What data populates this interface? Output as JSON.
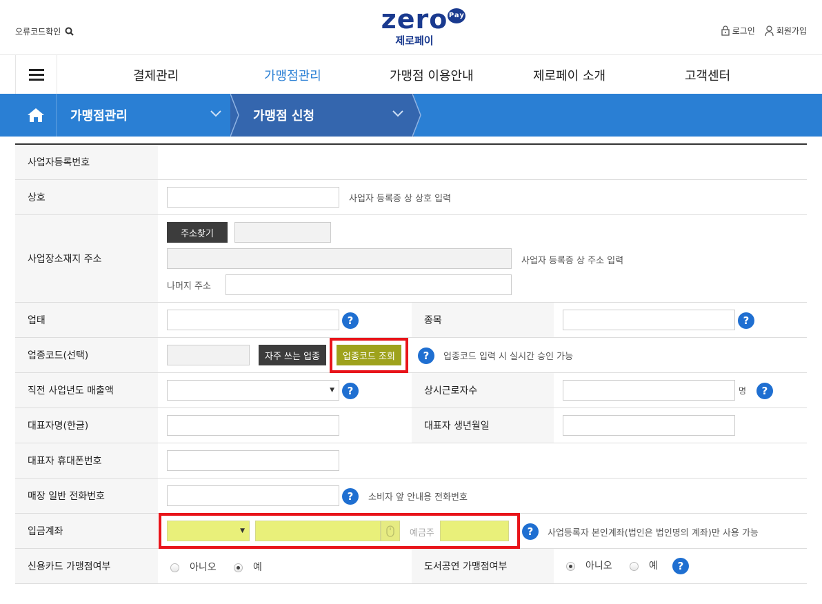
{
  "header": {
    "error_code_link": "오류코드확인",
    "logo_text": "zero",
    "logo_badge": "Pay",
    "logo_korean": "제로페이",
    "login": "로그인",
    "signup": "회원가입"
  },
  "gnb": {
    "items": [
      "결제관리",
      "가맹점관리",
      "가맹점 이용안내",
      "제로페이 소개",
      "고객센터"
    ],
    "active_index": 1
  },
  "breadcrumb": {
    "level1": "가맹점관리",
    "level2": "가맹점 신청"
  },
  "form": {
    "biz_reg_no": {
      "label": "사업자등록번호"
    },
    "company": {
      "label": "상호",
      "hint": "사업자 등록증 상 상호 입력"
    },
    "address": {
      "label": "사업장소재지 주소",
      "find_button": "주소찾기",
      "hint": "사업자 등록증 상 주소 입력",
      "rest_label": "나머지 주소"
    },
    "business_type": {
      "label": "업태"
    },
    "business_item": {
      "label": "종목"
    },
    "industry_code": {
      "label": "업종코드(선택)",
      "frequent_button": "자주 쓰는 업종",
      "lookup_button": "업종코드 조회",
      "hint": "업종코드 입력 시 실시간 승인 가능"
    },
    "sales": {
      "label": "직전 사업년도 매출액"
    },
    "employees": {
      "label": "상시근로자수",
      "unit": "명"
    },
    "rep_name": {
      "label": "대표자명(한글)"
    },
    "rep_birth": {
      "label": "대표자 생년월일"
    },
    "rep_phone": {
      "label": "대표자 휴대폰번호"
    },
    "store_phone": {
      "label": "매장 일반 전화번호",
      "hint": "소비자 앞 안내용 전화번호"
    },
    "account": {
      "label": "입금계좌",
      "holder_label": "예금주",
      "hint": "사업등록자 본인계좌(법인은 법인명의 계좌)만 사용 가능"
    },
    "credit_card": {
      "label": "신용카드 가맹점여부",
      "no": "아니오",
      "yes": "예",
      "selected": "예"
    },
    "book_culture": {
      "label": "도서공연 가맹점여부",
      "no": "아니오",
      "yes": "예",
      "selected": "아니오"
    }
  },
  "colors": {
    "brand_blue": "#1a3a8f",
    "accent": "#2a7fd4",
    "highlight_red": "#e8141a",
    "highlight_yellow": "#e9f07a"
  }
}
